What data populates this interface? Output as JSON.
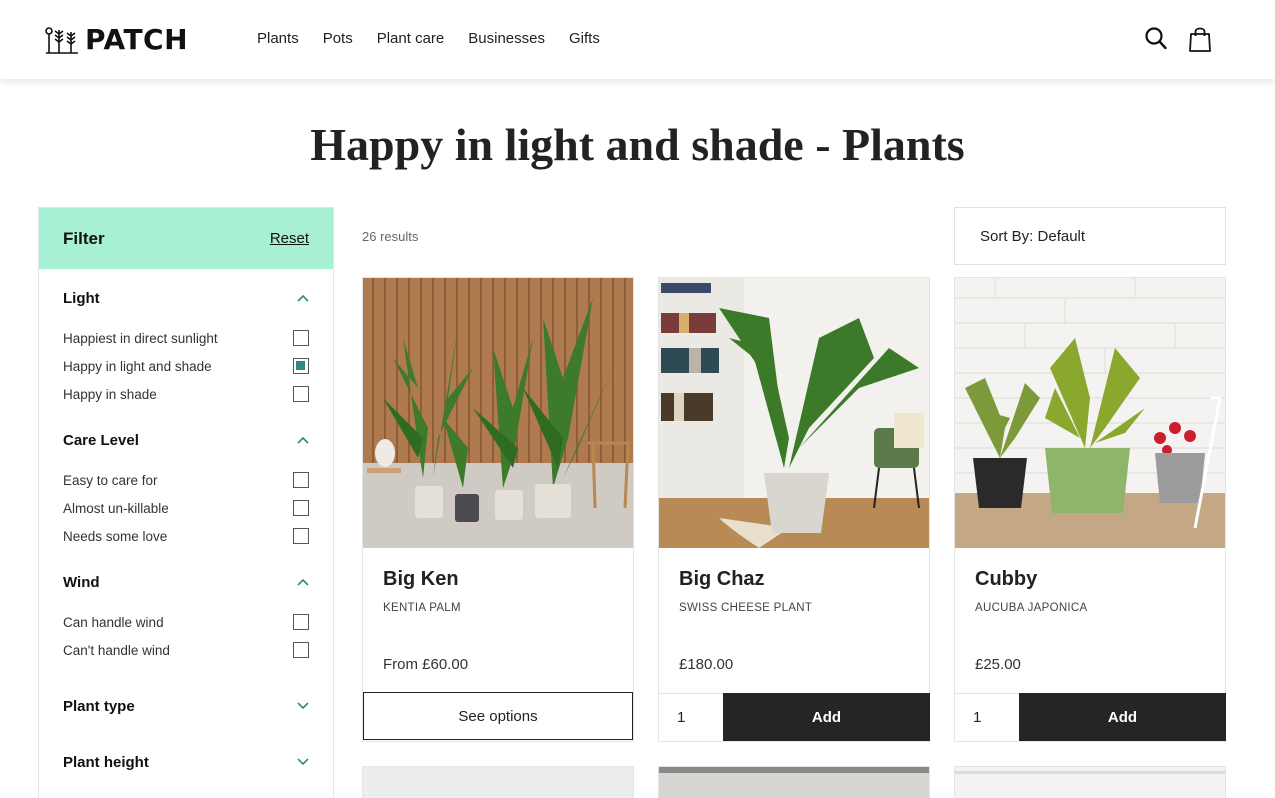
{
  "header": {
    "logo_text": "PATCH",
    "nav": [
      "Plants",
      "Pots",
      "Plant care",
      "Businesses",
      "Gifts"
    ],
    "icons": [
      "search-icon",
      "cart-bag-icon"
    ]
  },
  "page_title": "Happy in light and shade - Plants",
  "filter": {
    "title": "Filter",
    "reset": "Reset",
    "groups": [
      {
        "title": "Light",
        "expanded": true,
        "options": [
          {
            "label": "Happiest in direct sunlight",
            "checked": false
          },
          {
            "label": "Happy in light and shade",
            "checked": true
          },
          {
            "label": "Happy in shade",
            "checked": false
          }
        ]
      },
      {
        "title": "Care Level",
        "expanded": true,
        "options": [
          {
            "label": "Easy to care for",
            "checked": false
          },
          {
            "label": "Almost un-killable",
            "checked": false
          },
          {
            "label": "Needs some love",
            "checked": false
          }
        ]
      },
      {
        "title": "Wind",
        "expanded": true,
        "options": [
          {
            "label": "Can handle wind",
            "checked": false
          },
          {
            "label": "Can't handle wind",
            "checked": false
          }
        ]
      },
      {
        "title": "Plant type",
        "expanded": false,
        "options": []
      },
      {
        "title": "Plant height",
        "expanded": false,
        "options": []
      }
    ]
  },
  "results_count": "26 results",
  "sort_label": "Sort By: Default",
  "products": [
    {
      "name": "Big Ken",
      "subtitle": "KENTIA PALM",
      "price": "From £60.00",
      "action": "See options"
    },
    {
      "name": "Big Chaz",
      "subtitle": "SWISS CHEESE PLANT",
      "price": "£180.00",
      "quantity": "1",
      "action": "Add"
    },
    {
      "name": "Cubby",
      "subtitle": "AUCUBA JAPONICA",
      "price": "£25.00",
      "quantity": "1",
      "action": "Add"
    }
  ],
  "colors": {
    "filter_header_bg": "#a7f0d3",
    "accent_teal": "#2e8b7f",
    "button_dark": "#252525"
  }
}
